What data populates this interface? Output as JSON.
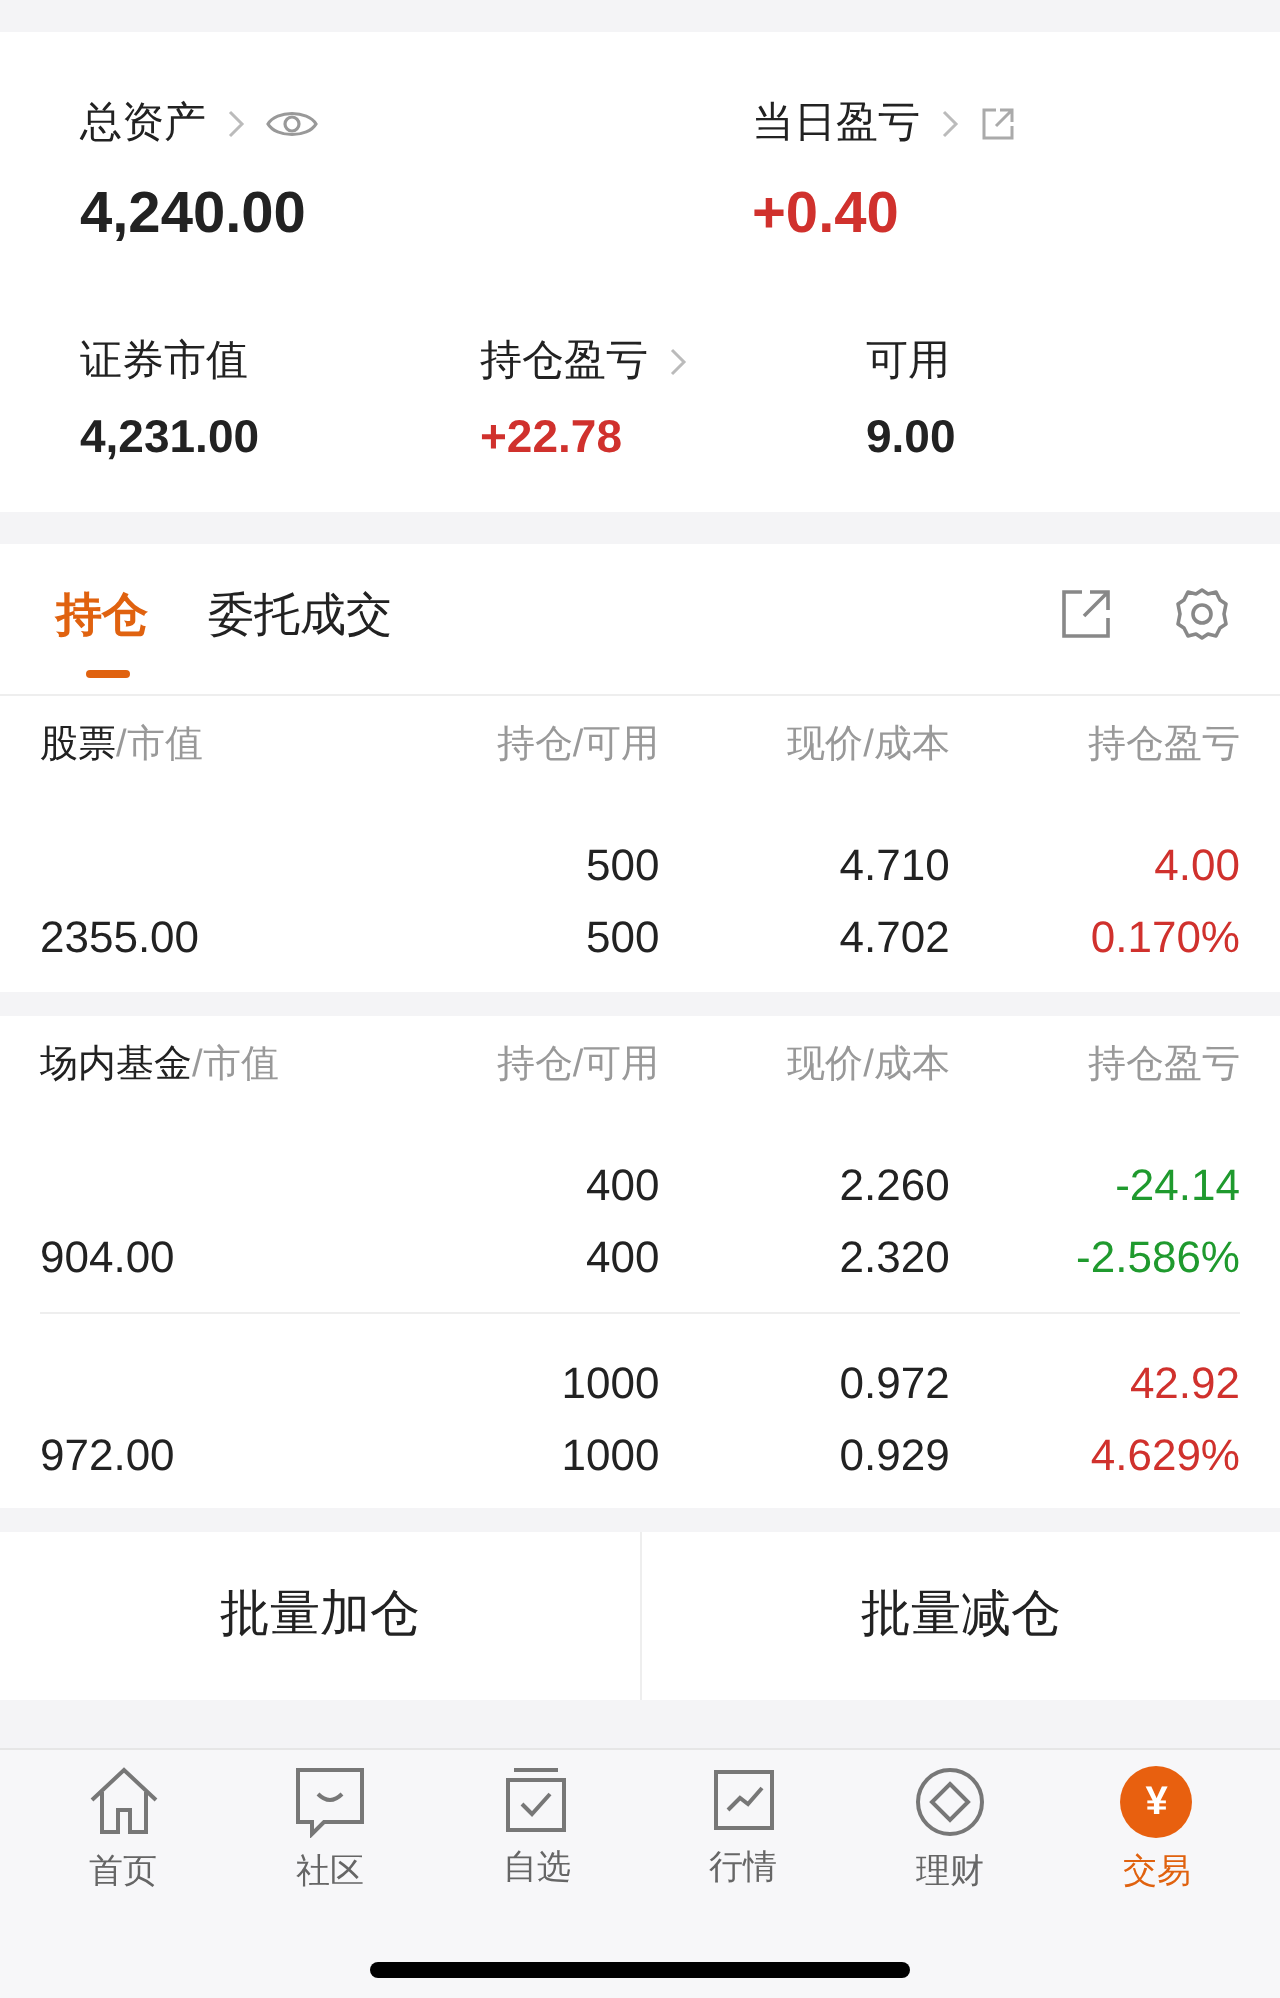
{
  "summary": {
    "total_assets": {
      "label": "总资产",
      "value": "4,240.00"
    },
    "daily_pnl": {
      "label": "当日盈亏",
      "value": "+0.40",
      "kind": "gain"
    },
    "stats": [
      {
        "label": "证券市值",
        "value": "4,231.00",
        "kind": "plain",
        "link": false
      },
      {
        "label": "持仓盈亏",
        "value": "+22.78",
        "kind": "gain",
        "link": true
      },
      {
        "label": "可用",
        "value": "9.00",
        "kind": "plain",
        "link": false
      }
    ]
  },
  "tabs": [
    {
      "label": "持仓",
      "selected": true
    },
    {
      "label": "委托成交",
      "selected": false
    }
  ],
  "sections": [
    {
      "columns": [
        {
          "main": "股票",
          "sub": "/市值"
        },
        {
          "main": "持仓",
          "sub": "/可用"
        },
        {
          "main": "现价",
          "sub": "/成本"
        },
        {
          "main": "持仓盈亏"
        }
      ],
      "rows": [
        {
          "market_value": "2355.00",
          "holding": "500",
          "available": "500",
          "price": "4.710",
          "cost": "4.702",
          "pnl": "4.00",
          "pnl_pct": "0.170%",
          "kind": "gain"
        }
      ]
    },
    {
      "columns": [
        {
          "main": "场内基金",
          "sub": "/市值"
        },
        {
          "main": "持仓",
          "sub": "/可用"
        },
        {
          "main": "现价",
          "sub": "/成本"
        },
        {
          "main": "持仓盈亏"
        }
      ],
      "rows": [
        {
          "market_value": "904.00",
          "holding": "400",
          "available": "400",
          "price": "2.260",
          "cost": "2.320",
          "pnl": "-24.14",
          "pnl_pct": "-2.586%",
          "kind": "loss"
        },
        {
          "market_value": "972.00",
          "holding": "1000",
          "available": "1000",
          "price": "0.972",
          "cost": "0.929",
          "pnl": "42.92",
          "pnl_pct": "4.629%",
          "kind": "gain"
        }
      ]
    }
  ],
  "actions": [
    "批量加仓",
    "批量减仓"
  ],
  "nav": [
    {
      "label": "首页",
      "kind": "home",
      "selected": false
    },
    {
      "label": "社区",
      "kind": "chat",
      "selected": false
    },
    {
      "label": "自选",
      "kind": "check",
      "selected": false
    },
    {
      "label": "行情",
      "kind": "chart",
      "selected": false
    },
    {
      "label": "理财",
      "kind": "diamond",
      "selected": false
    },
    {
      "label": "交易",
      "kind": "glyph",
      "glyph": "¥",
      "selected": true
    }
  ]
}
